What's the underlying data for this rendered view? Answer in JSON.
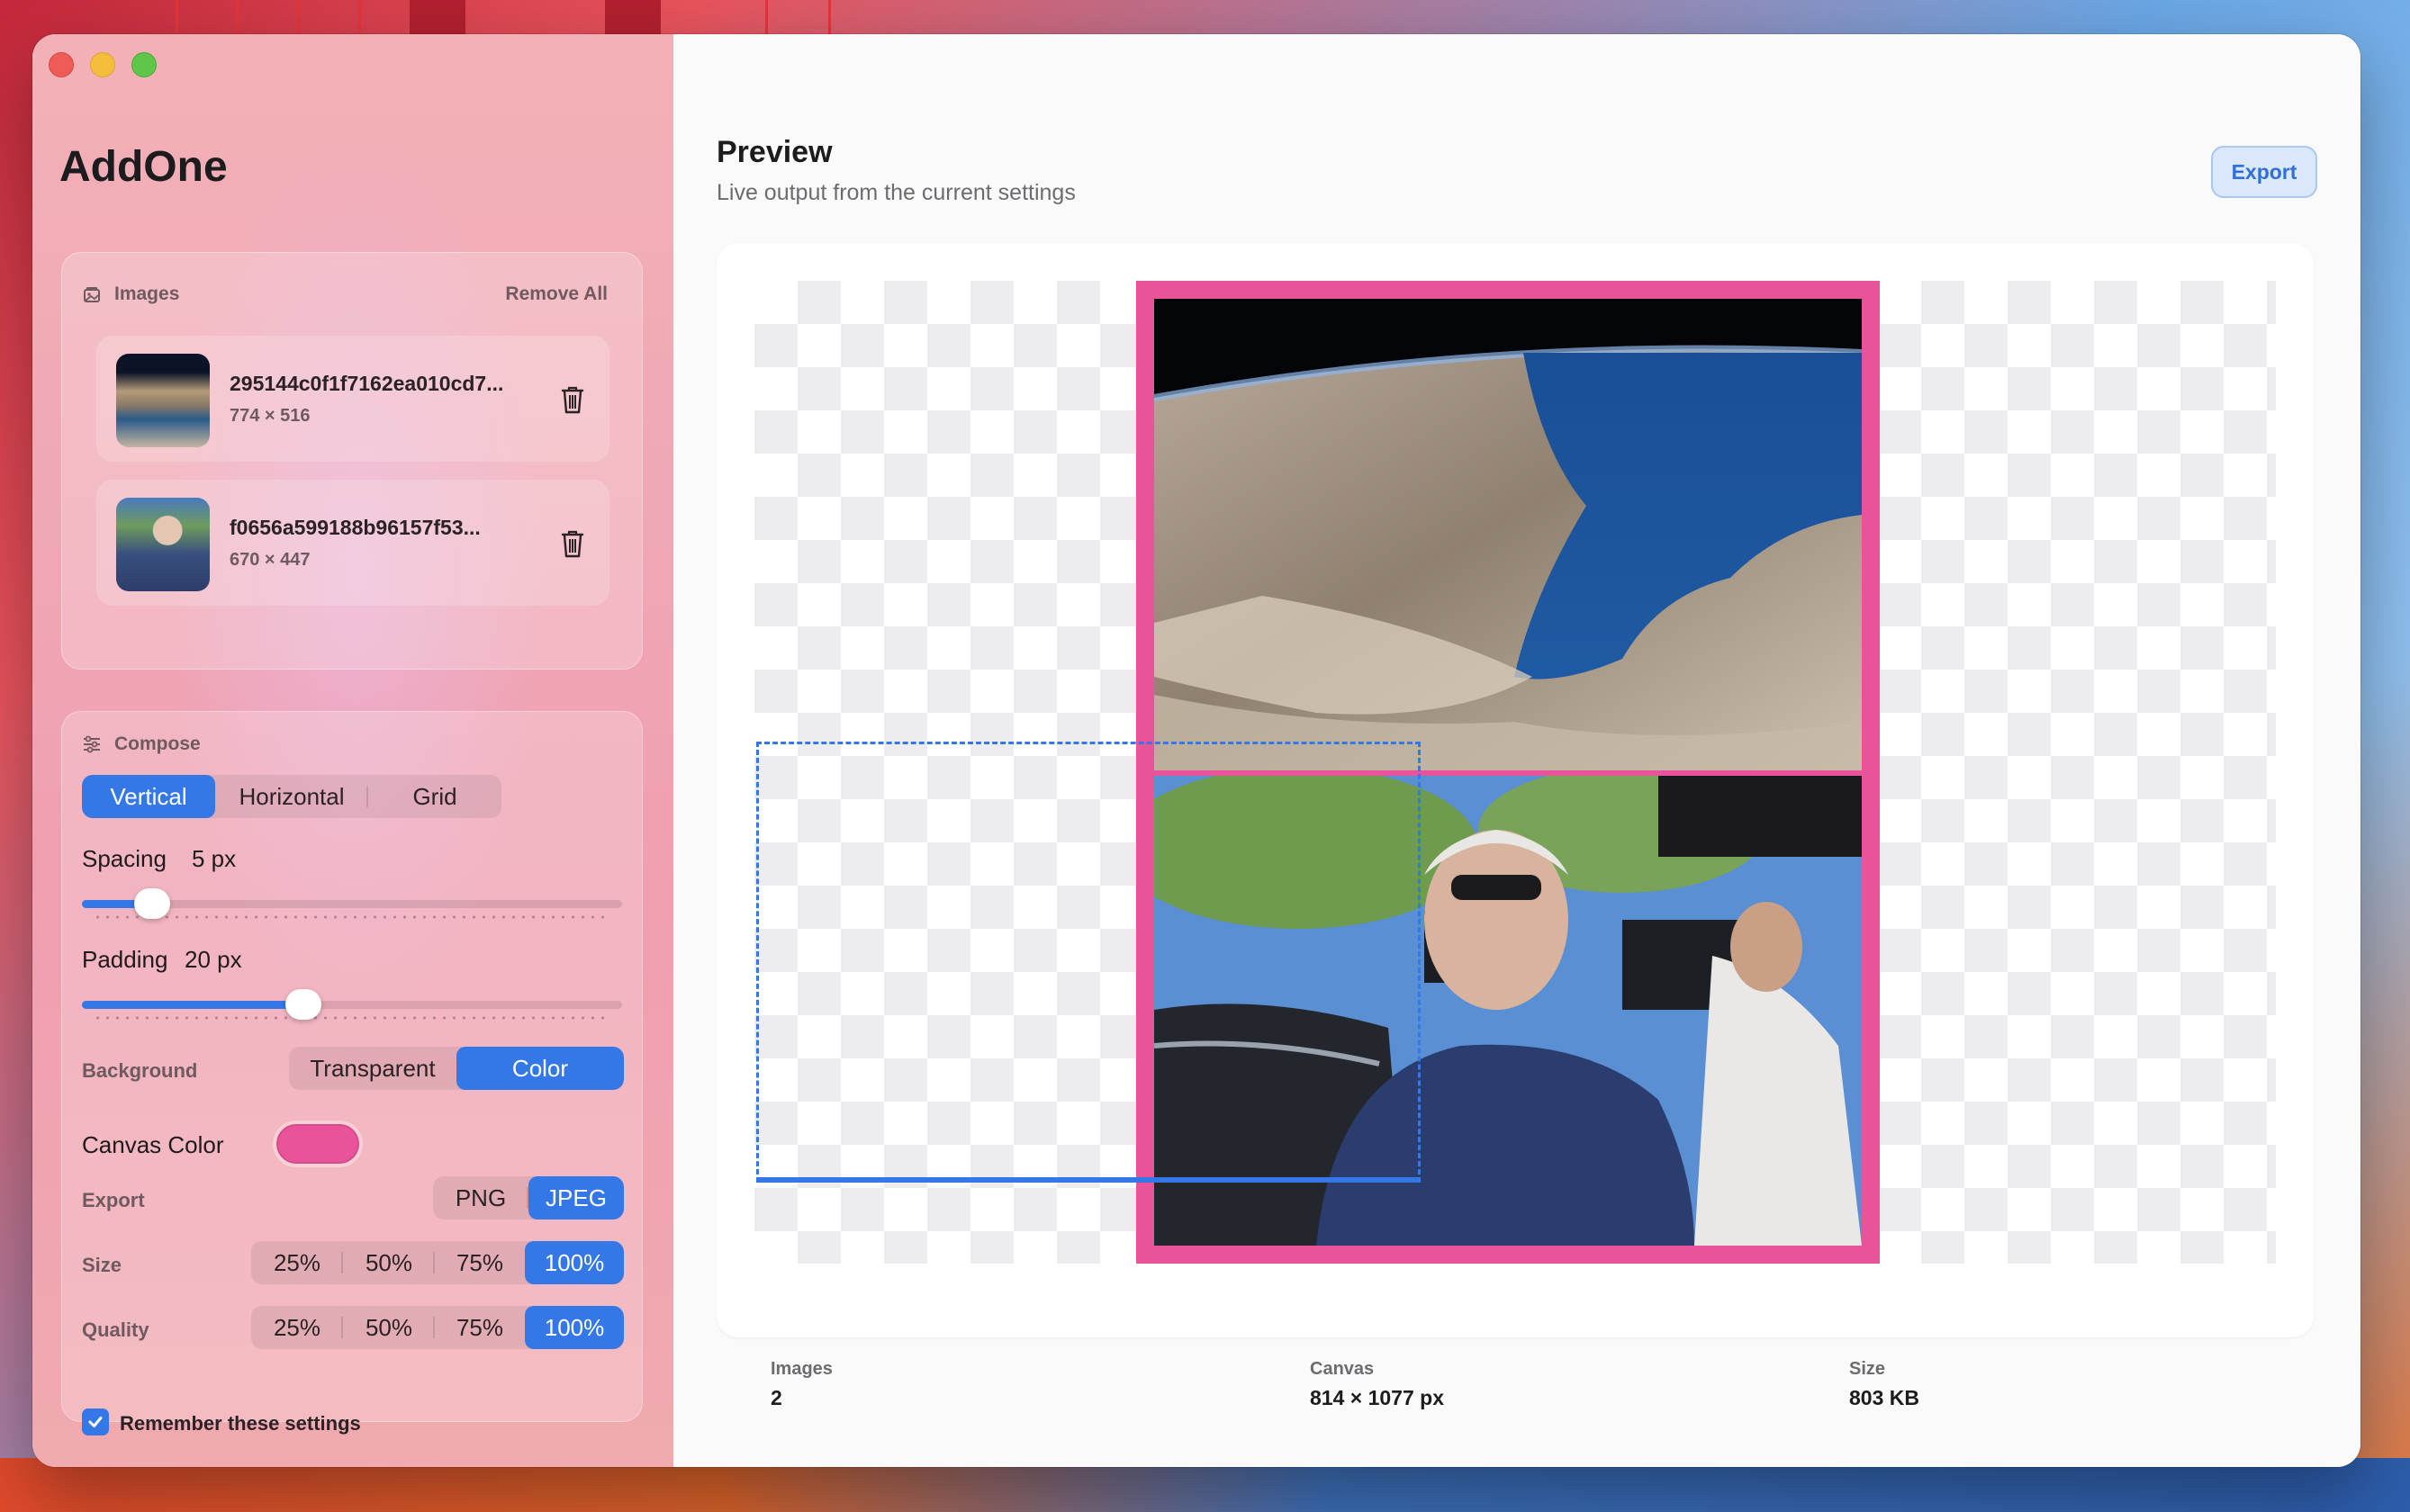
{
  "app": {
    "title": "AddOne"
  },
  "images_panel": {
    "heading": "Images",
    "remove_all": "Remove All",
    "items": [
      {
        "name": "295144c0f1f7162ea010cd7...",
        "dims": "774 × 516"
      },
      {
        "name": "f0656a599188b96157f53...",
        "dims": "670 × 447"
      }
    ]
  },
  "compose": {
    "heading": "Compose",
    "layout_options": [
      "Vertical",
      "Horizontal",
      "Grid"
    ],
    "layout_selected": "Vertical",
    "spacing": {
      "label": "Spacing",
      "value": "5 px",
      "level_fraction": 0.13
    },
    "padding": {
      "label": "Padding",
      "value": "20 px",
      "level_fraction": 0.41
    },
    "background": {
      "label": "Background",
      "options": [
        "Transparent",
        "Color"
      ],
      "selected": "Color"
    },
    "canvas_color": {
      "label": "Canvas Color",
      "value": "#E8539A"
    },
    "export": {
      "label": "Export",
      "options": [
        "PNG",
        "JPEG"
      ],
      "selected": "JPEG"
    },
    "size": {
      "label": "Size",
      "options": [
        "25%",
        "50%",
        "75%",
        "100%"
      ],
      "selected": "100%"
    },
    "quality": {
      "label": "Quality",
      "options": [
        "25%",
        "50%",
        "75%",
        "100%"
      ],
      "selected": "100%"
    },
    "remember": {
      "label": "Remember these settings",
      "checked": true
    }
  },
  "preview": {
    "title": "Preview",
    "subtitle": "Live output from the current settings",
    "export_button": "Export"
  },
  "stats": {
    "images": {
      "label": "Images",
      "value": "2"
    },
    "canvas": {
      "label": "Canvas",
      "value": "814 × 1077 px"
    },
    "size": {
      "label": "Size",
      "value": "803 KB"
    }
  },
  "colors": {
    "accent": "#3478E8",
    "canvas": "#E8539A"
  }
}
